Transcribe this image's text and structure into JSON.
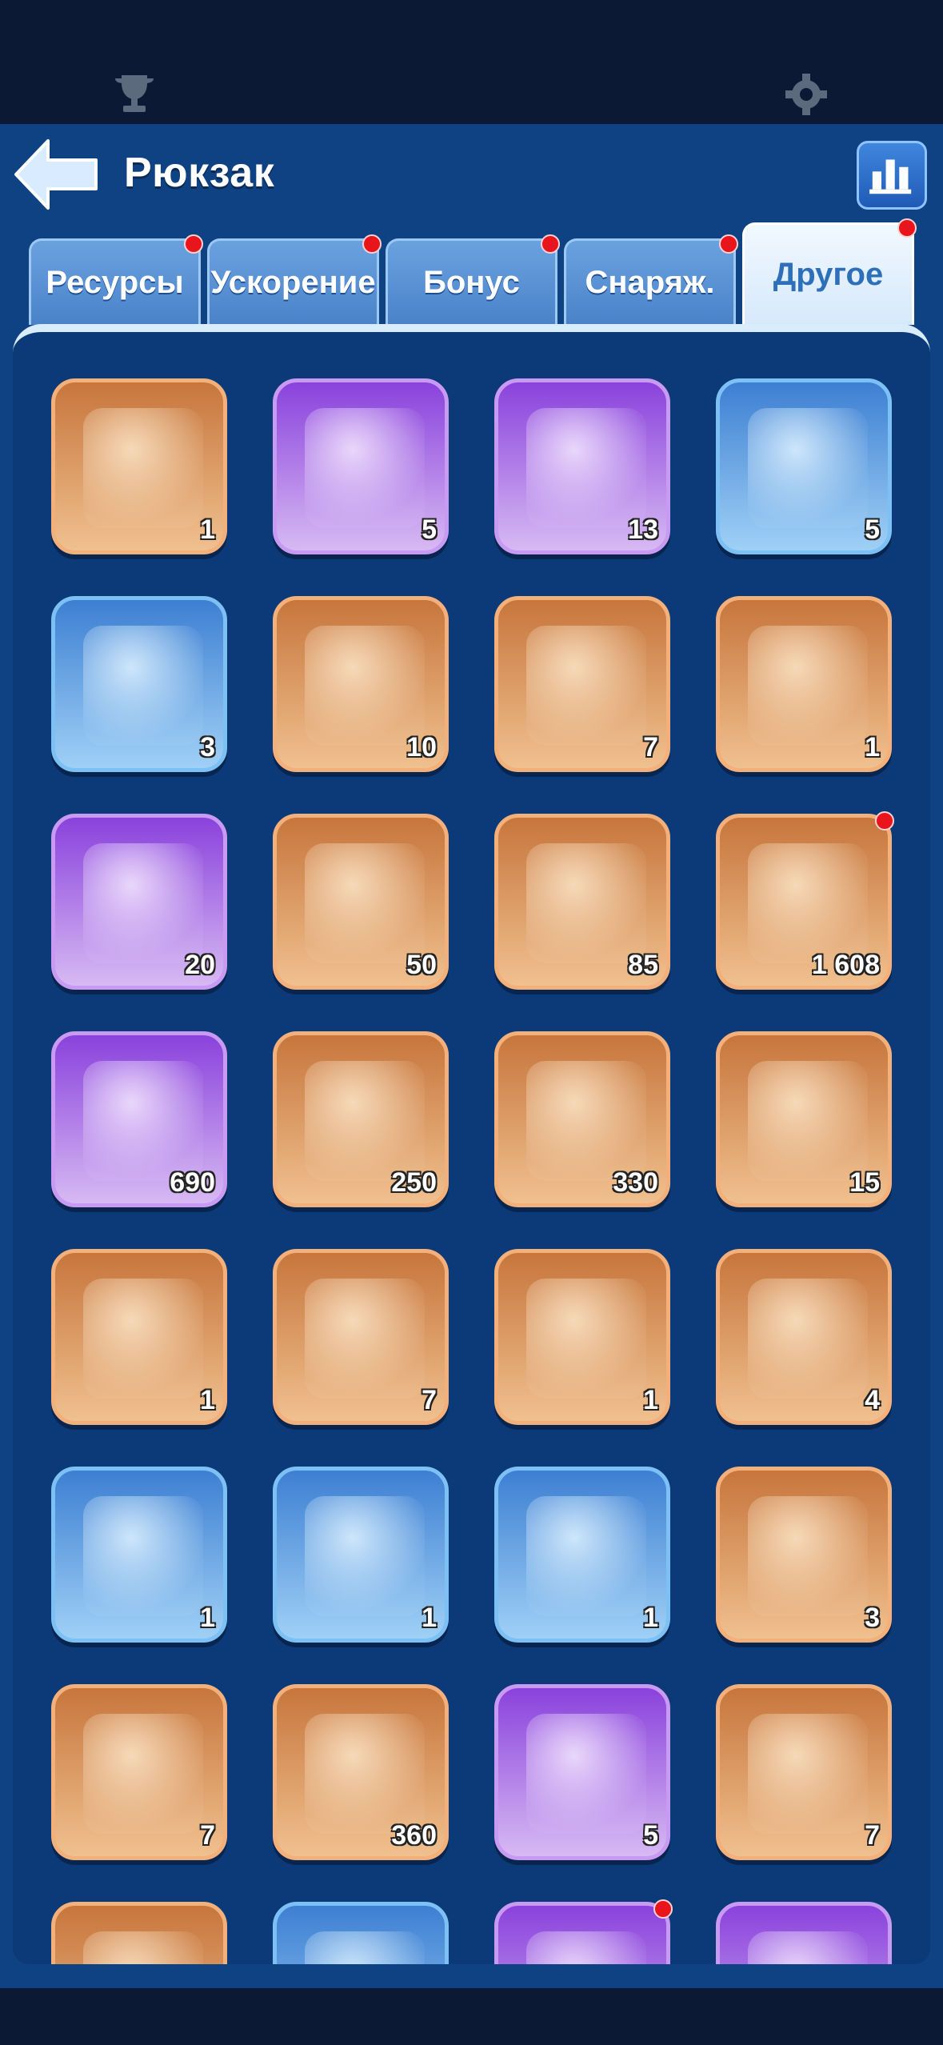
{
  "header": {
    "title": "Рюкзак"
  },
  "tabs": [
    {
      "label": "Ресурсы",
      "active": false,
      "badge": true
    },
    {
      "label": "Ускорение",
      "active": false,
      "badge": true
    },
    {
      "label": "Бонус",
      "active": false,
      "badge": true
    },
    {
      "label": "Снаряж.",
      "active": false,
      "badge": true
    },
    {
      "label": "Другое",
      "active": true,
      "badge": true
    }
  ],
  "items": [
    {
      "icon": "scroll-icon",
      "rarity": "orange",
      "qty": "1"
    },
    {
      "icon": "compass-speedup-icon",
      "rarity": "purple",
      "qty": "5"
    },
    {
      "icon": "castle-relocate-icon",
      "rarity": "purple",
      "qty": "13"
    },
    {
      "icon": "tower-relocate-icon",
      "rarity": "blue",
      "qty": "5"
    },
    {
      "icon": "banner-relocate-icon",
      "rarity": "blue",
      "qty": "3"
    },
    {
      "icon": "s2-chest-icon",
      "rarity": "orange",
      "qty": "10"
    },
    {
      "icon": "gold-chest-icon",
      "rarity": "orange",
      "qty": "7"
    },
    {
      "icon": "treasure-chest-icon",
      "rarity": "orange",
      "qty": "1"
    },
    {
      "icon": "puzzle-chest-icon",
      "rarity": "purple",
      "qty": "20"
    },
    {
      "icon": "rune-card-icon",
      "rarity": "orange",
      "qty": "50"
    },
    {
      "icon": "rose-icon",
      "rarity": "orange",
      "qty": "85"
    },
    {
      "icon": "soccer-ball-icon",
      "rarity": "orange",
      "qty": "1 608",
      "badge": true
    },
    {
      "icon": "mystery-badge-icon",
      "rarity": "purple",
      "qty": "690"
    },
    {
      "icon": "bell-icon",
      "rarity": "orange",
      "qty": "250"
    },
    {
      "icon": "paw-cookie-icon",
      "rarity": "orange",
      "qty": "330"
    },
    {
      "icon": "shell-token-icon",
      "rarity": "orange",
      "qty": "15"
    },
    {
      "icon": "flower-card-icon",
      "rarity": "orange",
      "qty": "1"
    },
    {
      "icon": "swap-ticket-icon",
      "rarity": "orange",
      "qty": "7"
    },
    {
      "icon": "fishing-ticket-icon",
      "rarity": "orange",
      "qty": "1"
    },
    {
      "icon": "conch-icon",
      "rarity": "orange",
      "qty": "4"
    },
    {
      "icon": "lantern-icon",
      "rarity": "blue",
      "qty": "1"
    },
    {
      "icon": "robot-icon",
      "rarity": "blue",
      "qty": "1"
    },
    {
      "icon": "fishing-reel-icon",
      "rarity": "blue",
      "qty": "1"
    },
    {
      "icon": "return-card-icon",
      "rarity": "orange",
      "qty": "3"
    },
    {
      "icon": "gold-ticket-icon",
      "rarity": "orange",
      "qty": "7"
    },
    {
      "icon": "scales-ticket-icon",
      "rarity": "orange",
      "qty": "360"
    },
    {
      "icon": "mystery-card-icon",
      "rarity": "purple",
      "qty": "5"
    },
    {
      "icon": "boat-ticket-icon",
      "rarity": "orange",
      "qty": "7"
    },
    {
      "icon": "yellow-card-icon",
      "rarity": "orange",
      "qty": ""
    },
    {
      "icon": "silver-heart-icon",
      "rarity": "blue",
      "qty": ""
    },
    {
      "icon": "gold-heart-icon",
      "rarity": "purple",
      "qty": "",
      "badge": true
    },
    {
      "icon": "tag-icon",
      "rarity": "purple",
      "qty": ""
    }
  ],
  "colors": {
    "panel": "#0f4283",
    "badge": "#e8151c",
    "accent": "#3f86de"
  }
}
